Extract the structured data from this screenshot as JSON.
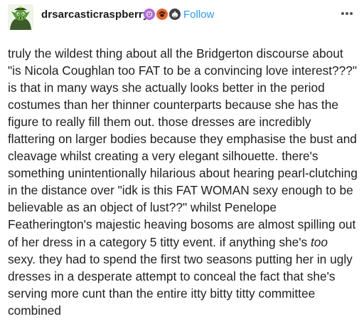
{
  "header": {
    "username": "drsarcasticraspberry",
    "follow_label": "Follow",
    "badges": [
      {
        "icon": "purple-sticker-badge-icon",
        "color": "#b06ad9"
      },
      {
        "icon": "paw-badge-icon",
        "color": "#e6632f"
      },
      {
        "icon": "pumpkin-badge-icon",
        "color": "#404040"
      }
    ],
    "more_icon": "ellipsis-icon",
    "avatar_icon": "goblin-avatar-icon"
  },
  "post": {
    "text_before": "truly the wildest thing about all the Bridgerton discourse about \"is Nicola Coughlan too FAT to be a convincing love interest???\" is that in many ways she actually looks better in the period costumes than her thinner counterparts because she has the figure to really fill them out. those dresses are incredibly flattering on larger bodies because they emphasise the bust and cleavage whilst creating a very elegant silhouette. there's something unintentionally hilarious about hearing pearl-clutching in the distance over \"idk is this FAT WOMAN sexy enough to be believable as an object of lust??\" whilst Penelope Featherington's majestic heaving bosoms are almost spilling out of her dress in a category 5 titty event. if anything she's ",
    "text_italic": "too",
    "text_after": " sexy. they had to spend the first two seasons putting her in ugly dresses in a desperate attempt to conceal the fact that she's serving more cunt than the entire itty bitty titty committee combined"
  },
  "colors": {
    "follow": "#2d9bf0",
    "text": "#1f1f1f"
  }
}
